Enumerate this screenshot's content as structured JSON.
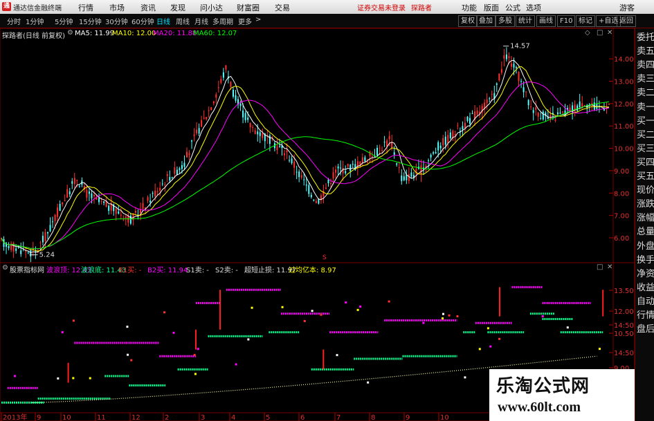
{
  "titlebar": {
    "app_title": "通达信金融终端",
    "menus": [
      "行情",
      "市场",
      "资讯",
      "发现",
      "问小达",
      "财富圈",
      "交易"
    ],
    "warning": "证券交易未登录",
    "user_link": "探路者",
    "right_menus": [
      "功能",
      "版面",
      "公式",
      "选项"
    ],
    "guest": "游客"
  },
  "toolbar": {
    "periods": [
      "分时",
      "1分钟",
      "5分钟",
      "15分钟",
      "30分钟",
      "60分钟",
      "日线",
      "周线",
      "月线",
      "多周期",
      "更多"
    ],
    "active_period": "日线",
    "right_buttons": [
      "复权",
      "叠加",
      "多股",
      "统计",
      "画线",
      "F10",
      "标记",
      "+自选",
      "返回"
    ]
  },
  "main_info": {
    "name": "探路者(日线 前复权)",
    "ma5": "MA5: 11.99",
    "ma10": "MA10: 12.00",
    "ma20": "MA20: 11.88",
    "ma60": "MA60: 12.07"
  },
  "colors": {
    "ma5": "#ffffff",
    "ma10": "#ffff00",
    "ma20": "#ff00ff",
    "ma60": "#00ff00",
    "up": "#ff3030",
    "down": "#54ffff",
    "grid": "#7a0000"
  },
  "annotations": {
    "high": "14.57",
    "low": "5.24",
    "s_marker": "S"
  },
  "price_axis": [
    "14.00",
    "13.00",
    "12.00",
    "11.00",
    "10.00",
    "9.00",
    "8.00",
    "7.00",
    "6.00"
  ],
  "sidebar": [
    "委托",
    "卖五",
    "卖四",
    "卖三",
    "卖二",
    "卖一",
    "买一",
    "买二",
    "买三",
    "买四",
    "买五",
    "现价",
    "涨跌",
    "涨幅",
    "总量",
    "外盘",
    "换手",
    "净资",
    "收益",
    "自动",
    "行情",
    "盘后"
  ],
  "indicator": {
    "name": "股票指标网",
    "fields": [
      {
        "label": "波浪顶: 12.43",
        "color": "#ff00ff"
      },
      {
        "label": "波浪底: 11.43",
        "color": "#00ff90"
      },
      {
        "label": "B1买: -",
        "color": "#ff3030"
      },
      {
        "label": "B2买: 11.94",
        "color": "#ff00ff"
      },
      {
        "label": "S1卖: -",
        "color": "#dddddd"
      },
      {
        "label": "S2卖: -",
        "color": "#dddddd"
      },
      {
        "label": "超短止损: 11.97",
        "color": "#dddddd"
      },
      {
        "label": "过均亿本: 8.97",
        "color": "#ffff00"
      }
    ],
    "axis": [
      "13.50",
      "12.00",
      "14:50",
      "10.50",
      "14:50",
      "9.00"
    ]
  },
  "date_axis": [
    "2013年",
    "9",
    "10",
    "11",
    "12",
    "2",
    "3",
    "4",
    "5",
    "6",
    "7",
    "8",
    "9",
    "10"
  ],
  "watermark": {
    "title": "乐淘公式网",
    "url": "www.60lt.com"
  }
}
